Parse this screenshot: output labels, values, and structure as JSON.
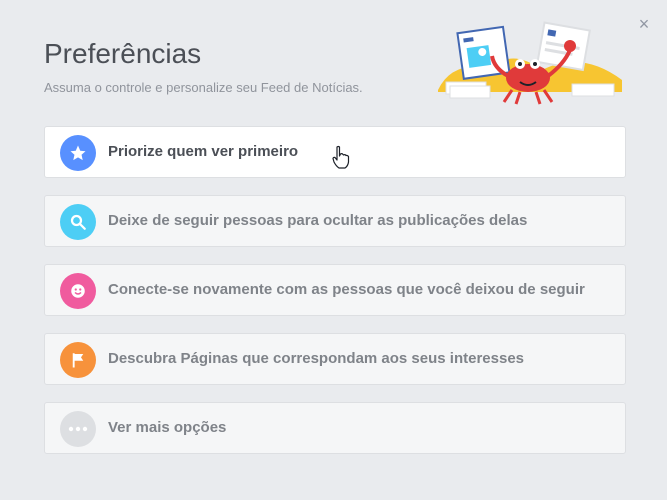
{
  "dialog": {
    "title": "Preferências",
    "subtitle": "Assuma o controle e personalize seu Feed de Notícias.",
    "close_glyph": "×"
  },
  "options": [
    {
      "label": "Priorize quem ver primeiro",
      "icon": "star-icon",
      "color": "#5890ff"
    },
    {
      "label": "Deixe de seguir pessoas para ocultar as publicações delas",
      "icon": "search-icon",
      "color": "#4dcef5"
    },
    {
      "label": "Conecte-se novamente com as pessoas que você deixou de seguir",
      "icon": "smiley-icon",
      "color": "#f05b9e"
    },
    {
      "label": "Descubra Páginas que correspondam aos seus interesses",
      "icon": "flag-icon",
      "color": "#f7923b"
    },
    {
      "label": "Ver mais opções",
      "icon": "more-dots-icon",
      "color": "#dddfe2"
    }
  ]
}
